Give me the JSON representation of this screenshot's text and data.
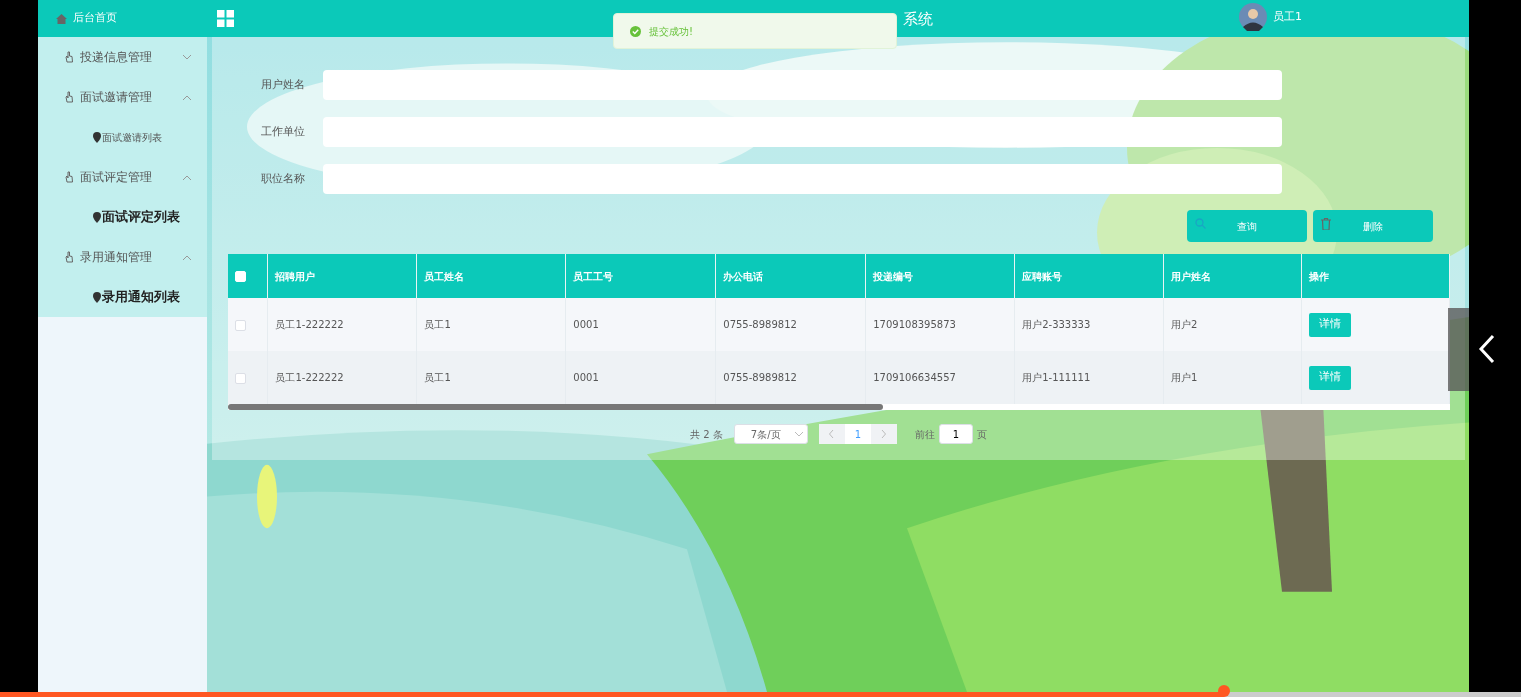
{
  "sidebar": {
    "home": "后台首页",
    "groups": [
      {
        "label": "投递信息管理",
        "expanded": false
      },
      {
        "label": "面试邀请管理",
        "expanded": true,
        "children": [
          {
            "label": "面试邀请列表",
            "selected": false
          }
        ]
      },
      {
        "label": "面试评定管理",
        "expanded": true,
        "children": [
          {
            "label": "面试评定列表",
            "selected": true
          }
        ]
      },
      {
        "label": "录用通知管理",
        "expanded": true,
        "children": [
          {
            "label": "录用通知列表",
            "selected": true
          }
        ]
      }
    ]
  },
  "topbar": {
    "title": "系统",
    "user": "员工1"
  },
  "toast": {
    "text": "提交成功!"
  },
  "search_fields": [
    {
      "label": "用户姓名"
    },
    {
      "label": "工作单位"
    },
    {
      "label": "职位名称"
    }
  ],
  "buttons": [
    {
      "label": "查询",
      "kind": "search"
    },
    {
      "label": "删除",
      "kind": "delete"
    }
  ],
  "table": {
    "header_checked": false,
    "columns": [
      "招聘用户",
      "员工姓名",
      "员工工号",
      "办公电话",
      "投递编号",
      "应聘账号",
      "用户姓名",
      "操作"
    ],
    "rows": [
      {
        "checked": false,
        "cells": [
          "员工1-222222",
          "员工1",
          "0001",
          "0755-8989812",
          "1709108395873",
          "用户2-333333",
          "用户2"
        ],
        "action": "详情"
      },
      {
        "checked": false,
        "cells": [
          "员工1-222222",
          "员工1",
          "0001",
          "0755-8989812",
          "1709106634557",
          "用户1-111111",
          "用户1"
        ],
        "action": "详情"
      }
    ]
  },
  "pagination": {
    "total": "共 2 条",
    "page_size": "7条/页",
    "pages": [
      {
        "label": "1",
        "selected": true
      }
    ],
    "goto_label": "前往",
    "goto_value": "1",
    "goto_suffix": "页"
  },
  "player": {
    "level": 0.805
  }
}
